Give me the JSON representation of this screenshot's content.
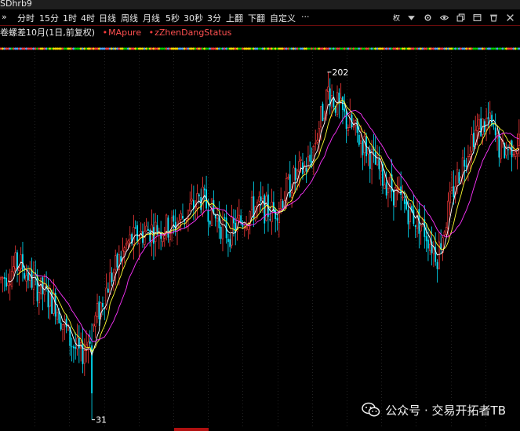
{
  "window": {
    "title": "SDhrb9"
  },
  "toolbar": {
    "expand": "»",
    "periods": [
      "分时",
      "15分",
      "1时",
      "4时",
      "日线",
      "周线",
      "月线",
      "5秒",
      "30秒",
      "3分",
      "上翻",
      "下翻",
      "自定义",
      "···"
    ],
    "right_label": "权"
  },
  "legend": {
    "symbol_text": "卷螺差10月(1日,前复权)",
    "indicator1": "MApure",
    "indicator2": "zZhenDangStatus",
    "dot_color": "#ff3b3b"
  },
  "chart_data": {
    "type": "candlestick",
    "max_label": "202",
    "min_label": "31",
    "price_range": [
      27,
      212
    ],
    "colors": {
      "up": "#ff3b3b",
      "down": "#00e5ff",
      "ma5": "#ffffff",
      "ma10": "#ffff33",
      "ma20": "#ff33ff"
    },
    "status_colors": [
      "#ff3b3b",
      "#ffd700",
      "#00c800",
      "#4aa3ff"
    ],
    "anchors": [
      [
        0,
        100
      ],
      [
        10,
        108
      ],
      [
        20,
        96
      ],
      [
        30,
        88
      ],
      [
        38,
        70
      ],
      [
        44,
        62
      ],
      [
        52,
        80
      ],
      [
        60,
        100
      ],
      [
        70,
        118
      ],
      [
        80,
        124
      ],
      [
        95,
        126
      ],
      [
        110,
        140
      ],
      [
        125,
        122
      ],
      [
        140,
        136
      ],
      [
        150,
        133
      ],
      [
        160,
        148
      ],
      [
        170,
        158
      ],
      [
        180,
        193
      ],
      [
        190,
        178
      ],
      [
        200,
        166
      ],
      [
        210,
        150
      ],
      [
        222,
        136
      ],
      [
        232,
        126
      ],
      [
        240,
        112
      ],
      [
        250,
        148
      ],
      [
        260,
        172
      ],
      [
        268,
        178
      ],
      [
        275,
        163
      ],
      [
        285,
        168
      ]
    ]
  },
  "watermark": {
    "text": "公众号 · 交易开拓者TB"
  }
}
